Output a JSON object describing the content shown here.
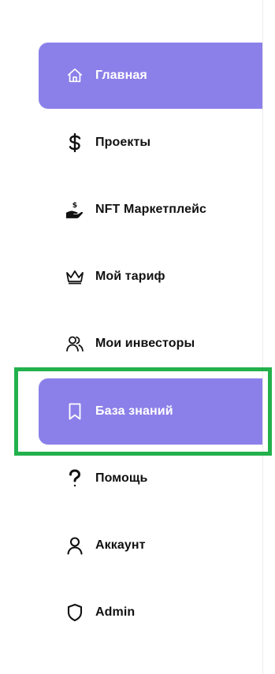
{
  "sidebar": {
    "items": [
      {
        "label": "Главная",
        "icon": "home-icon"
      },
      {
        "label": "Проекты",
        "icon": "dollar-icon"
      },
      {
        "label": "NFT Маркетплейс",
        "icon": "hand-coin-icon"
      },
      {
        "label": "Мой тариф",
        "icon": "crown-icon"
      },
      {
        "label": "Мои инвесторы",
        "icon": "users-icon"
      },
      {
        "label": "База знаний",
        "icon": "bookmark-icon"
      },
      {
        "label": "Помощь",
        "icon": "question-icon"
      },
      {
        "label": "Аккаунт",
        "icon": "user-icon"
      },
      {
        "label": "Admin",
        "icon": "shield-icon"
      }
    ],
    "active_items": [
      "Главная",
      "База знаний"
    ],
    "highlighted_item": "База знаний"
  },
  "colors": {
    "active_background": "#8b80e9",
    "active_text": "#ffffff",
    "text": "#111111",
    "highlight_border": "#22b14c"
  }
}
